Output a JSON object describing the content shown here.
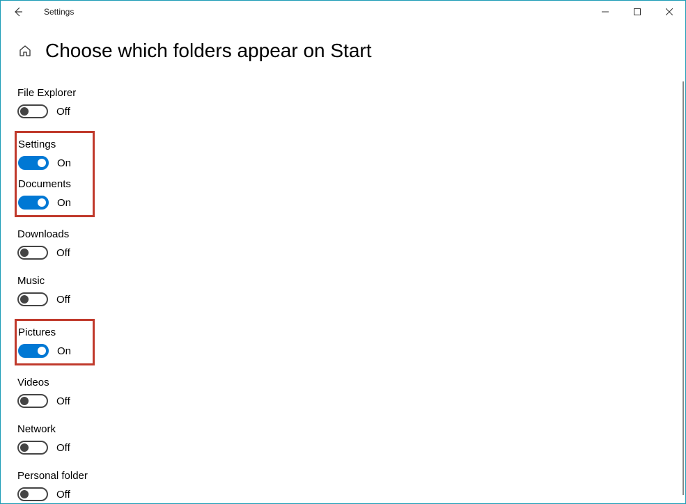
{
  "window": {
    "title": "Settings"
  },
  "page": {
    "title": "Choose which folders appear on Start"
  },
  "states": {
    "on": "On",
    "off": "Off"
  },
  "settings": [
    {
      "label": "File Explorer",
      "on": false,
      "highlight_group": null
    },
    {
      "label": "Settings",
      "on": true,
      "highlight_group": 1
    },
    {
      "label": "Documents",
      "on": true,
      "highlight_group": 1
    },
    {
      "label": "Downloads",
      "on": false,
      "highlight_group": null
    },
    {
      "label": "Music",
      "on": false,
      "highlight_group": null
    },
    {
      "label": "Pictures",
      "on": true,
      "highlight_group": 2
    },
    {
      "label": "Videos",
      "on": false,
      "highlight_group": null
    },
    {
      "label": "Network",
      "on": false,
      "highlight_group": null
    },
    {
      "label": "Personal folder",
      "on": false,
      "highlight_group": null
    }
  ]
}
